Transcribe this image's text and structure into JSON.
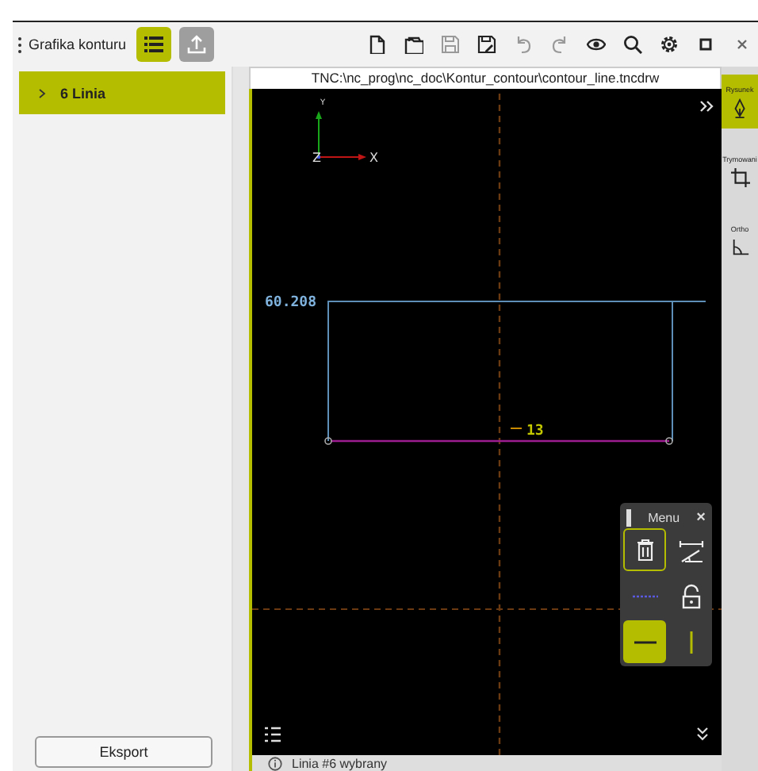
{
  "header": {
    "title": "Grafika konturu",
    "buttons": [
      {
        "kind": "list",
        "selected": true,
        "disabled": false
      },
      {
        "kind": "export",
        "selected": false,
        "disabled": true
      }
    ]
  },
  "toolbar": [
    {
      "kind": "new",
      "disabled": false
    },
    {
      "kind": "open",
      "disabled": false
    },
    {
      "kind": "save",
      "disabled": true
    },
    {
      "kind": "save-as",
      "disabled": false
    },
    {
      "kind": "undo",
      "disabled": true
    },
    {
      "kind": "redo",
      "disabled": true
    },
    {
      "kind": "view",
      "disabled": false
    },
    {
      "kind": "search",
      "disabled": false
    },
    {
      "kind": "settings",
      "disabled": false
    },
    {
      "kind": "maximize",
      "disabled": false
    },
    {
      "kind": "close",
      "disabled": false
    }
  ],
  "elements": [
    {
      "label": "6 Linia",
      "selected": true
    }
  ],
  "export_button": "Eksport",
  "path": "TNC:\\nc_prog\\nc_doc\\Kontur_contour\\contour_line.tncdrw",
  "canvas": {
    "axes": {
      "y": "Y",
      "z": "Z",
      "x": "X"
    },
    "dimension": "60.208",
    "line_number": "13"
  },
  "menu": {
    "title": "Menu",
    "close": "×",
    "tools": [
      {
        "kind": "delete",
        "selected": false,
        "focused": true
      },
      {
        "kind": "dimension",
        "selected": false,
        "focused": false
      },
      {
        "kind": "construction",
        "selected": false,
        "focused": false
      },
      {
        "kind": "lock",
        "selected": false,
        "focused": false
      },
      {
        "kind": "horizontal",
        "selected": true,
        "focused": false
      },
      {
        "kind": "vertical",
        "selected": false,
        "focused": false
      }
    ]
  },
  "status": "Linia #6 wybrany",
  "side_tools": [
    {
      "label": "Rysunek",
      "kind": "draw",
      "selected": true
    },
    {
      "label": "Trymowani",
      "kind": "trim",
      "selected": false
    },
    {
      "label": "Ortho",
      "kind": "ortho",
      "selected": false
    }
  ]
}
